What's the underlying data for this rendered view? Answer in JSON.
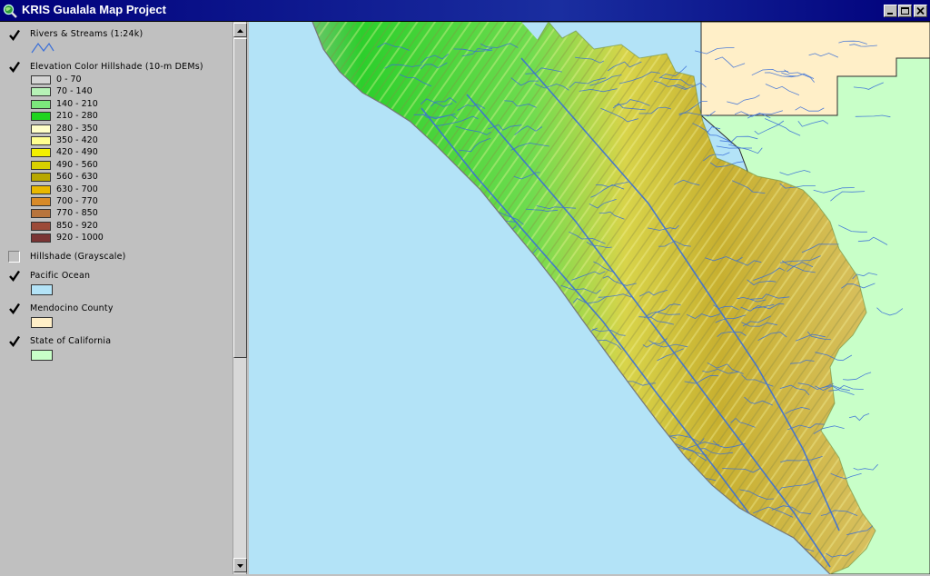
{
  "window": {
    "title": "KRIS Gualala Map Project",
    "icon": "magnifier-globe-icon",
    "controls": [
      "minimize-icon",
      "maximize-icon",
      "close-icon"
    ]
  },
  "legend": {
    "layers": [
      {
        "id": "rivers",
        "label": "Rivers & Streams (1:24k)",
        "checked": true,
        "symbol": "line",
        "color": "#3a6fd8"
      },
      {
        "id": "elevation",
        "label": "Elevation Color Hillshade (10-m DEMs)",
        "checked": true,
        "classes": [
          {
            "label": "0 - 70",
            "color": "#d4d4d4"
          },
          {
            "label": "70 - 140",
            "color": "#b6f2b6"
          },
          {
            "label": "140 - 210",
            "color": "#7ce87c"
          },
          {
            "label": "210 - 280",
            "color": "#1ed41e"
          },
          {
            "label": "280 - 350",
            "color": "#ffffc8"
          },
          {
            "label": "350 - 420",
            "color": "#ffff90"
          },
          {
            "label": "420 - 490",
            "color": "#f2f000"
          },
          {
            "label": "490 - 560",
            "color": "#d8d000"
          },
          {
            "label": "560 - 630",
            "color": "#b8a800"
          },
          {
            "label": "630 - 700",
            "color": "#e8b800"
          },
          {
            "label": "700 - 770",
            "color": "#d88a28"
          },
          {
            "label": "770 - 850",
            "color": "#b8743c"
          },
          {
            "label": "850 - 920",
            "color": "#9c4a38"
          },
          {
            "label": "920 - 1000",
            "color": "#7a3434"
          }
        ]
      },
      {
        "id": "hillshade",
        "label": "Hillshade (Grayscale)",
        "checked": false
      },
      {
        "id": "ocean",
        "label": "Pacific Ocean",
        "checked": true,
        "symbol": "fill",
        "color": "#b3e3f7"
      },
      {
        "id": "mendocino",
        "label": "Mendocino County",
        "checked": true,
        "symbol": "fill",
        "color": "#ffefc8"
      },
      {
        "id": "california",
        "label": "State of California",
        "checked": true,
        "symbol": "fill",
        "color": "#c8ffc8"
      }
    ]
  },
  "scrollbar": {
    "up": "arrow-up-icon",
    "down": "arrow-down-icon"
  },
  "map": {
    "colors": {
      "ocean": "#b3e3f7",
      "mendocino": "#ffefc8",
      "california": "#c8ffc8",
      "boundary": "#2b2b2b",
      "stream": "#3a6fd8"
    }
  }
}
